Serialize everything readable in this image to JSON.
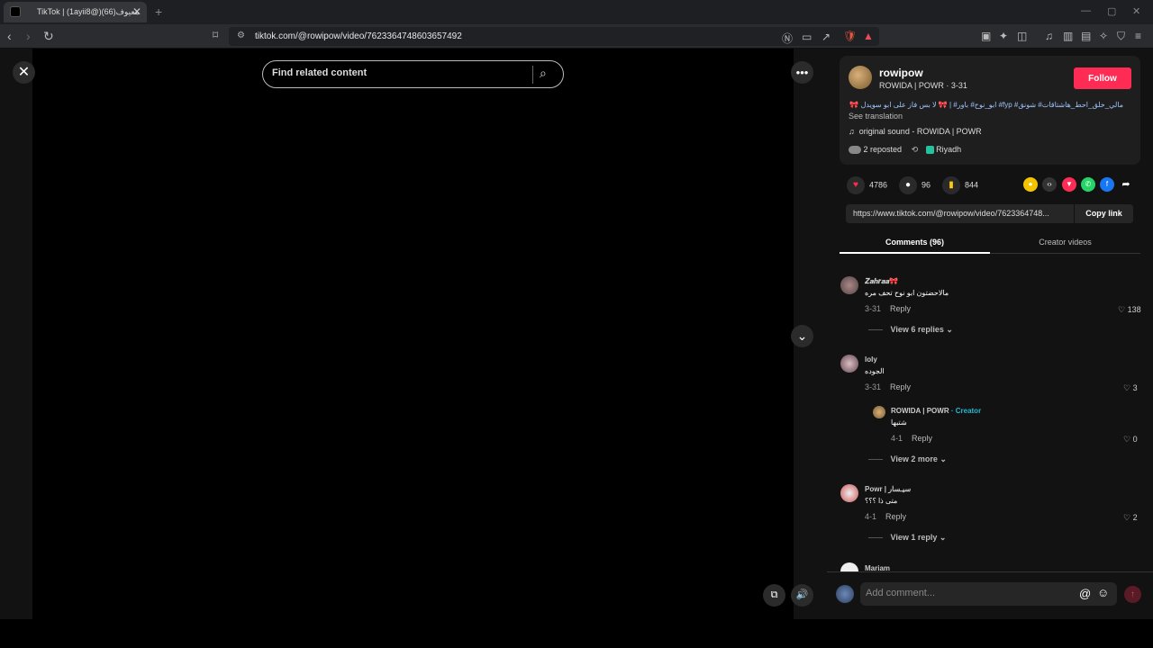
{
  "browser": {
    "tab_title": "TikTok | (1ayii8@)معيوف(66)",
    "tab_close": "✕",
    "new_tab": "+",
    "url": "tiktok.com/@rowipow/video/7623364748603657492"
  },
  "player": {
    "search_placeholder": "Find related content"
  },
  "post": {
    "username": "rowipow",
    "subname": "ROWIDA | POWR · 3-31",
    "follow_label": "Follow",
    "caption": "مالي_خلق_احط_هاشتاقات# شونق# fyp# ابو_نوح# باور# | 🎀 لا بس فاز على ابو سويدل 🎀",
    "see_translation": "See translation",
    "sound": "original sound - ROWIDA | POWR",
    "reposts": "2 reposted",
    "location": "Riyadh",
    "likes": "4786",
    "comments": "96",
    "saves": "844",
    "share_link": "https://www.tiktok.com/@rowipow/video/7623364748...",
    "copy_link_label": "Copy link"
  },
  "tabs": {
    "comments": "Comments (96)",
    "creator_videos": "Creator videos"
  },
  "comments": [
    {
      "name": "𝒁𝒂𝒉𝒓𝒂𝒂🎀",
      "text": "مالاحضتون ابو نوح تحف مره",
      "date": "3-31",
      "reply": "Reply",
      "likes": "138",
      "view": "View 6 replies"
    },
    {
      "name": "loly",
      "text": "الجوده",
      "date": "3-31",
      "reply": "Reply",
      "likes": "3",
      "view": "View 2 more"
    },
    {
      "name": "ROWIDA | POWR",
      "creator_tag": "· Creator",
      "text": "شتبها",
      "date": "4-1",
      "reply": "Reply",
      "likes": "0"
    },
    {
      "name": "Powr | ﺳﻴـﺴﺎر",
      "text": "متى ذا ؟؟؟",
      "date": "4-1",
      "reply": "Reply",
      "likes": "2",
      "view": "View 1 reply"
    },
    {
      "name": "Mariam"
    }
  ],
  "composer": {
    "placeholder": "Add comment..."
  }
}
